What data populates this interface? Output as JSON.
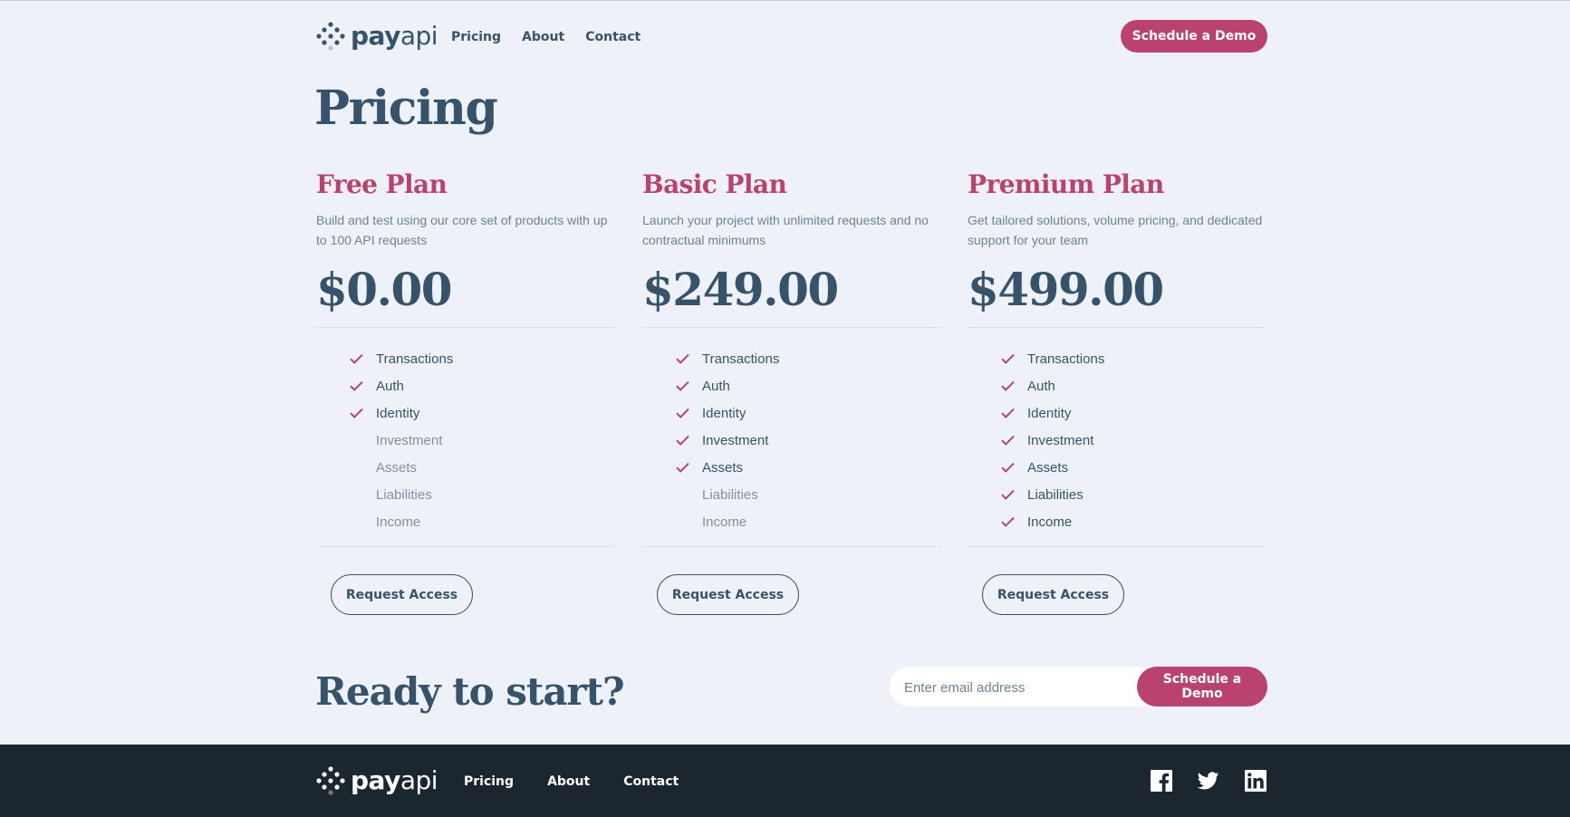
{
  "header": {
    "logo": {
      "pay": "pay",
      "api": "api",
      "icon": "dots-logo-icon"
    },
    "nav": [
      "Pricing",
      "About",
      "Contact"
    ],
    "cta": "Schedule a Demo"
  },
  "page_title": "Pricing",
  "plans": [
    {
      "name": "Free Plan",
      "description": "Build and test using our core set of products with up to 100 API requests",
      "price": "$0.00",
      "features": [
        {
          "label": "Transactions",
          "included": true
        },
        {
          "label": "Auth",
          "included": true
        },
        {
          "label": "Identity",
          "included": true
        },
        {
          "label": "Investment",
          "included": false
        },
        {
          "label": "Assets",
          "included": false
        },
        {
          "label": "Liabilities",
          "included": false
        },
        {
          "label": "Income",
          "included": false
        }
      ],
      "button": "Request Access"
    },
    {
      "name": "Basic Plan",
      "description": "Launch your project with unlimited requests and no contractual minimums",
      "price": "$249.00",
      "features": [
        {
          "label": "Transactions",
          "included": true
        },
        {
          "label": "Auth",
          "included": true
        },
        {
          "label": "Identity",
          "included": true
        },
        {
          "label": "Investment",
          "included": true
        },
        {
          "label": "Assets",
          "included": true
        },
        {
          "label": "Liabilities",
          "included": false
        },
        {
          "label": "Income",
          "included": false
        }
      ],
      "button": "Request Access"
    },
    {
      "name": "Premium Plan",
      "description": "Get tailored solutions, volume pricing, and dedicated support for your team",
      "price": "$499.00",
      "features": [
        {
          "label": "Transactions",
          "included": true
        },
        {
          "label": "Auth",
          "included": true
        },
        {
          "label": "Identity",
          "included": true
        },
        {
          "label": "Investment",
          "included": true
        },
        {
          "label": "Assets",
          "included": true
        },
        {
          "label": "Liabilities",
          "included": true
        },
        {
          "label": "Income",
          "included": true
        }
      ],
      "button": "Request Access"
    }
  ],
  "ready": {
    "title": "Ready to start?",
    "email_placeholder": "Enter email address",
    "button": "Schedule a Demo"
  },
  "footer": {
    "logo": {
      "pay": "pay",
      "api": "api",
      "icon": "dots-logo-icon"
    },
    "nav": [
      "Pricing",
      "About",
      "Contact"
    ],
    "social_icons": [
      "facebook-icon",
      "twitter-icon",
      "linkedin-icon"
    ]
  },
  "colors": {
    "background": "#eef2f8",
    "text_primary": "#36536b",
    "accent": "#ba4270",
    "muted": "#6c8294",
    "footer_bg": "#1b262f"
  }
}
